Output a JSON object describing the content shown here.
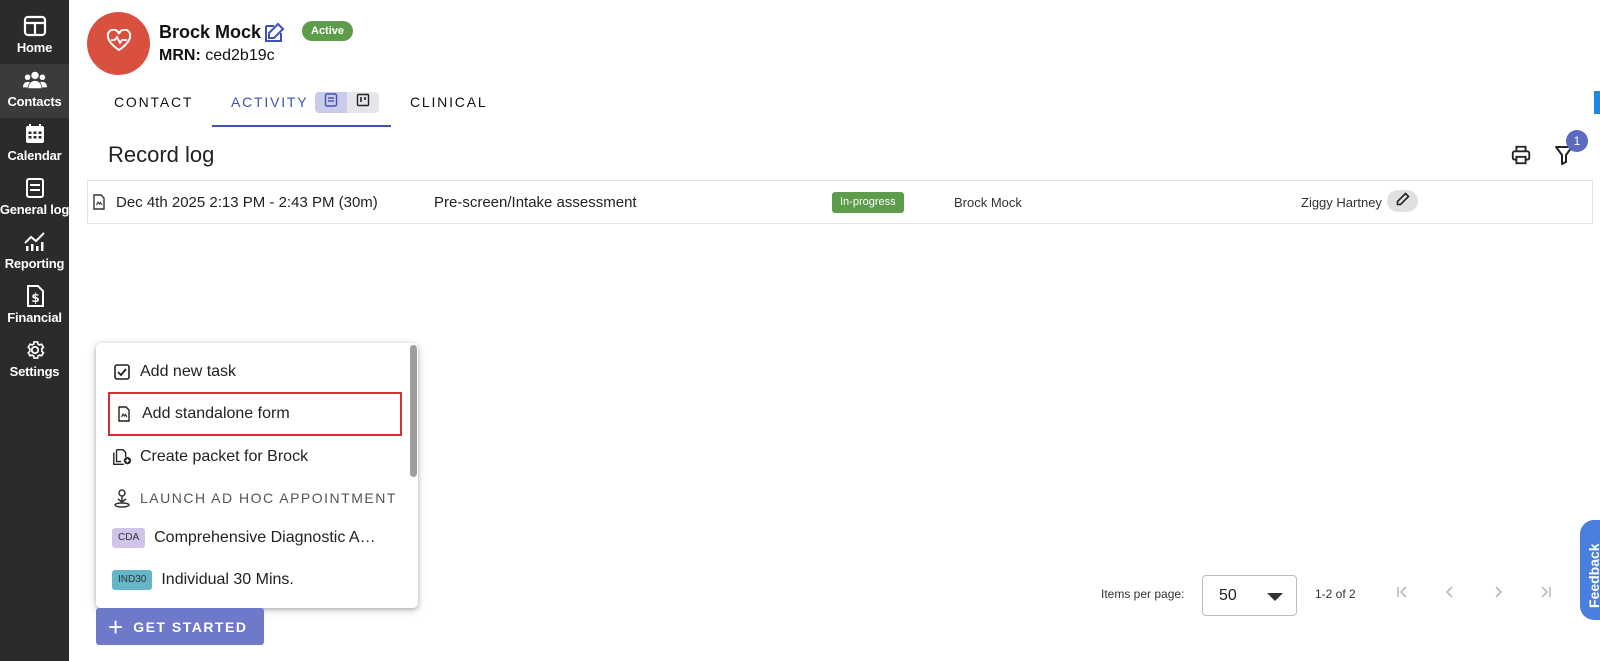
{
  "sidebar": {
    "items": [
      {
        "label": "Home",
        "icon": "home-icon"
      },
      {
        "label": "Contacts",
        "icon": "contacts-icon",
        "active": true
      },
      {
        "label": "Calendar",
        "icon": "calendar-icon"
      },
      {
        "label": "General log",
        "icon": "general-log-icon"
      },
      {
        "label": "Reporting",
        "icon": "reporting-icon"
      },
      {
        "label": "Financial",
        "icon": "financial-icon"
      },
      {
        "label": "Settings",
        "icon": "gear-icon"
      }
    ]
  },
  "patient": {
    "name": "Brock Mock",
    "status": "Active",
    "mrn_label": "MRN:",
    "mrn": "ced2b19c"
  },
  "tabs": [
    {
      "label": "CONTACT"
    },
    {
      "label": "ACTIVITY",
      "active": true
    },
    {
      "label": "CLINICAL"
    }
  ],
  "record_log": {
    "title": "Record log",
    "filter_count": "1",
    "rows": [
      {
        "datetime": "Dec 4th 2025 2:13 PM - 2:43 PM (30m)",
        "type": "Pre-screen/Intake assessment",
        "status": "In-progress",
        "patient": "Brock Mock",
        "provider": "Ziggy Hartney"
      }
    ]
  },
  "menu": {
    "add_task": "Add new task",
    "add_form": "Add standalone form",
    "create_packet": "Create packet for Brock",
    "launch_heading": "LAUNCH AD HOC APPOINTMENT",
    "appointments": [
      {
        "chip": "CDA",
        "label": "Comprehensive Diagnostic A…",
        "chip_color": "#d1c4e9"
      },
      {
        "chip": "IND30",
        "label": "Individual 30 Mins.",
        "chip_color": "#64b5c8"
      }
    ]
  },
  "get_started": {
    "label": "GET STARTED"
  },
  "pagination": {
    "items_per_page_label": "Items per page:",
    "items_per_page": "50",
    "range": "1-2 of 2"
  },
  "feedback": {
    "label": "Feedback"
  },
  "colors": {
    "sidebar": "#2b2b2b",
    "accent": "#3f51b5",
    "status_green": "#5d9c4a",
    "avatar": "#d9503f",
    "highlight_border": "#d32f2f"
  }
}
